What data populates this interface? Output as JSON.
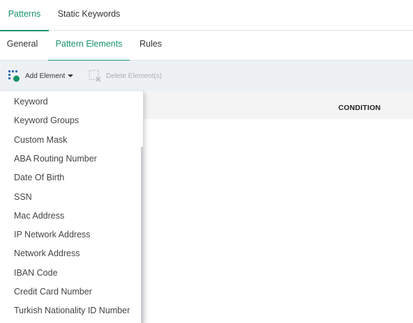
{
  "top_tabs": [
    {
      "label": "Patterns",
      "active": true
    },
    {
      "label": "Static Keywords",
      "active": false
    }
  ],
  "sub_tabs": [
    {
      "label": "General",
      "active": false
    },
    {
      "label": "Pattern Elements",
      "active": true
    },
    {
      "label": "Rules",
      "active": false
    }
  ],
  "toolbar": {
    "add_label": "Add Element",
    "add_icon": "add-element-icon",
    "delete_label": "Delete Element(s)",
    "delete_icon": "delete-element-icon",
    "delete_enabled": false
  },
  "table": {
    "columns": [
      "CONDITION"
    ]
  },
  "dropdown": {
    "items": [
      "Keyword",
      "Keyword Groups",
      "Custom Mask",
      "ABA Routing Number",
      "Date Of Birth",
      "SSN",
      "Mac Address",
      "IP Network Address",
      "Network Address",
      "IBAN Code",
      "Credit Card Number",
      "Turkish Nationality ID Number"
    ]
  },
  "colors": {
    "accent": "#17936a",
    "toolbar_bg": "#eef1f4",
    "header_bg": "#f4f4f4",
    "disabled_text": "#a9adb2"
  }
}
